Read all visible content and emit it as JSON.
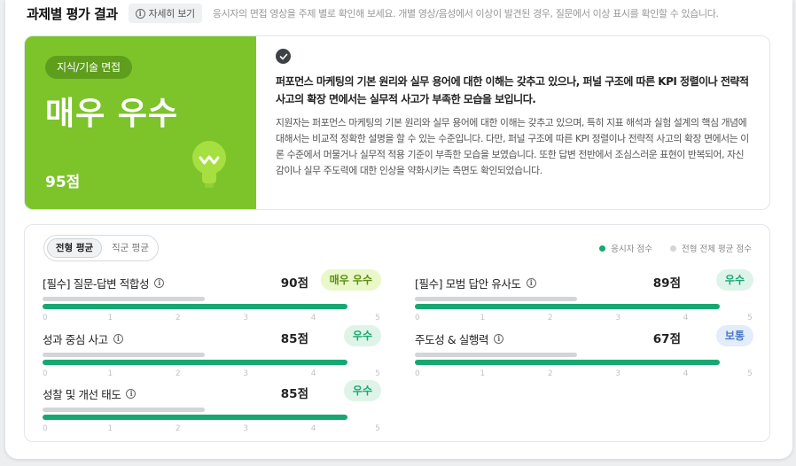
{
  "header": {
    "title": "과제별 평가 결과",
    "detail_label": "자세히 보기",
    "description": "응시자의 면접 영상을 주제 별로 확인해 보세요. 개별 영상/음성에서 이상이 발견된 경우, 질문에서 이상 표시를 확인할 수 있습니다."
  },
  "summary": {
    "category": "지식/기술 면접",
    "grade": "매우 우수",
    "score": "95점",
    "headline": "퍼포먼스 마케팅의 기본 원리와 실무 용어에 대한 이해는 갖추고 있으나, 퍼널 구조에 따른 KPI 정렬이나 전략적 사고의 확장 면에서는 실무적 사고가 부족한 모습을 보입니다.",
    "body": "지원자는 퍼포먼스 마케팅의 기본 원리와 실무 용어에 대한 이해는 갖추고 있으며, 특히 지표 해석과 실험 설계의 핵심 개념에 대해서는 비교적 정확한 설명을 할 수 있는 수준입니다. 다만, 퍼널 구조에 따른 KPI 정렬이나 전략적 사고의 확장 면에서는 이론 수준에서 머물거나 실무적 적용 기준이 부족한 모습을 보였습니다. 또한 답변 전반에서 조심스러운 표현이 반복되어, 자신감이나 실무 주도력에 대한 인상을 약화시키는 측면도 확인되었습니다.",
    "panel_color": "#7cc42a"
  },
  "scores": {
    "tab_active": "전형 평균",
    "tab_inactive": "직군 평균",
    "legend_me": "응시자 점수",
    "legend_avg": "전형 전체 평균 점수",
    "color_me": "#17a872",
    "color_avg": "#d3d5d8",
    "axis_ticks": [
      "0",
      "1",
      "2",
      "3",
      "4",
      "5"
    ],
    "items": [
      {
        "label": "[필수] 질문-답변 적합성",
        "score": "90점",
        "badge": "매우 우수",
        "badge_bg": "#eaf7c9",
        "badge_fg": "#5a8f12",
        "me_value": 4.5,
        "avg_value": 2.4
      },
      {
        "label": "성과 중심 사고",
        "score": "85점",
        "badge": "우수",
        "badge_bg": "#dff4e8",
        "badge_fg": "#17a872",
        "me_value": 4.5,
        "avg_value": 2.4
      },
      {
        "label": "성찰 및 개선 태도",
        "score": "85점",
        "badge": "우수",
        "badge_bg": "#dff4e8",
        "badge_fg": "#17a872",
        "me_value": 4.5,
        "avg_value": 2.4
      },
      {
        "label": "[필수] 모범 답안 유사도",
        "score": "89점",
        "badge": "우수",
        "badge_bg": "#dff4e8",
        "badge_fg": "#17a872",
        "me_value": 4.5,
        "avg_value": 2.4
      },
      {
        "label": "주도성 & 실행력",
        "score": "67점",
        "badge": "보통",
        "badge_bg": "#e3ecfb",
        "badge_fg": "#4a78c8",
        "me_value": 4.5,
        "avg_value": 2.4
      }
    ]
  }
}
